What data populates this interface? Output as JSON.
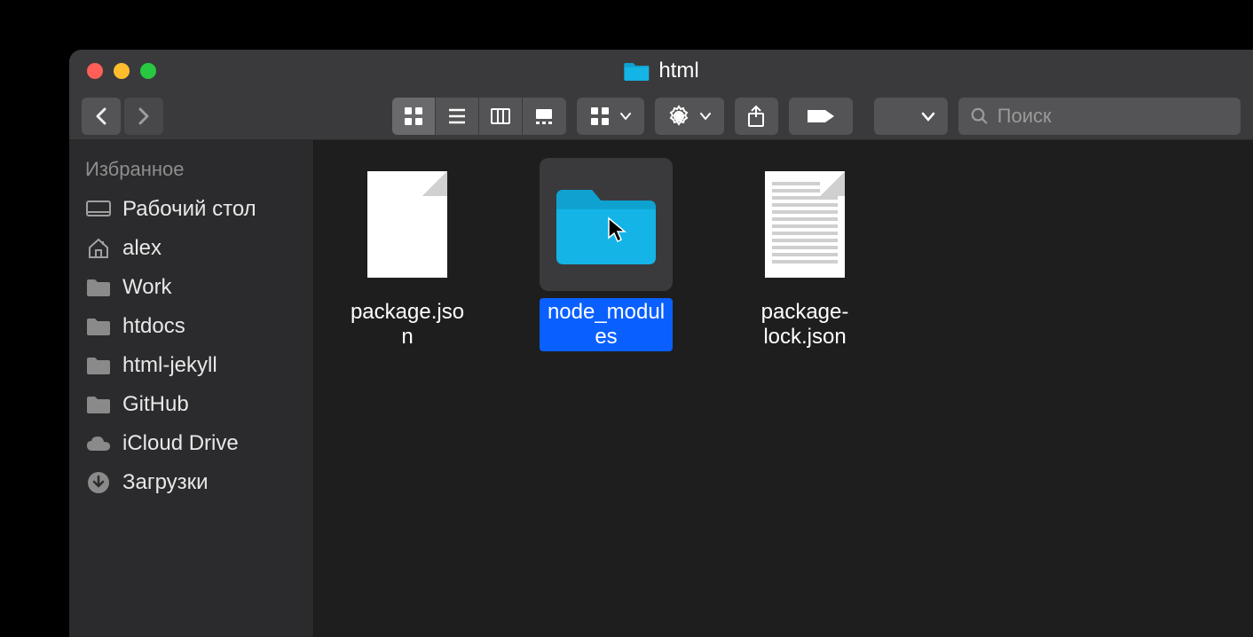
{
  "window": {
    "title": "html"
  },
  "search": {
    "placeholder": "Поиск"
  },
  "sidebar": {
    "header": "Избранное",
    "items": [
      {
        "label": "Рабочий стол",
        "icon": "desktop"
      },
      {
        "label": "alex",
        "icon": "home"
      },
      {
        "label": "Work",
        "icon": "folder"
      },
      {
        "label": "htdocs",
        "icon": "folder"
      },
      {
        "label": "html-jekyll",
        "icon": "folder"
      },
      {
        "label": "GitHub",
        "icon": "folder"
      },
      {
        "label": "iCloud Drive",
        "icon": "cloud"
      },
      {
        "label": "Загрузки",
        "icon": "download"
      }
    ]
  },
  "files": [
    {
      "name": "package.json",
      "type": "document",
      "selected": false
    },
    {
      "name": "node_modules",
      "type": "folder",
      "selected": true
    },
    {
      "name": "package-lock.json",
      "type": "document-lines",
      "selected": false
    }
  ],
  "colors": {
    "folder_accent": "#14b4e6",
    "selection": "#0a60ff"
  }
}
